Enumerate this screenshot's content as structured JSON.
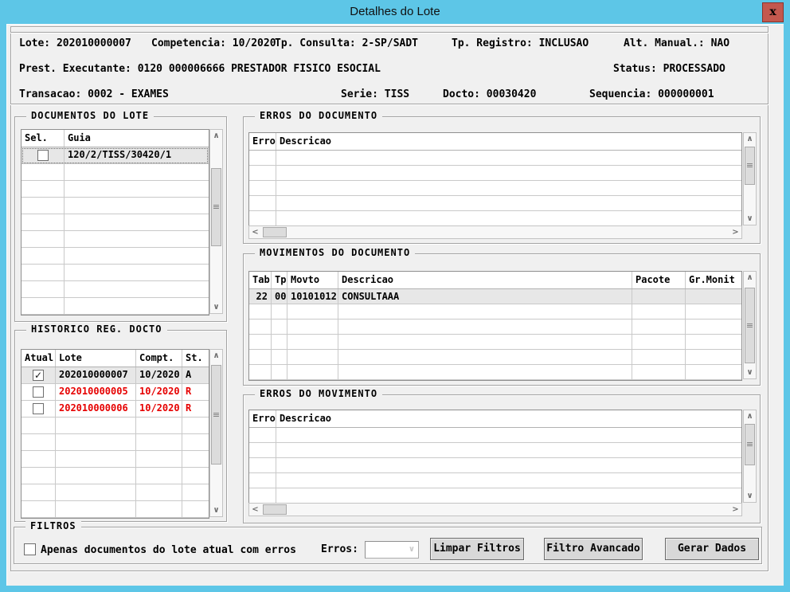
{
  "window": {
    "title": "Detalhes do Lote",
    "close_label": "x"
  },
  "colors": {
    "titlebar": "#5dc6e7",
    "panel_bg": "#f0f0f0",
    "close_bg": "#c3584e",
    "close_border": "#8b332b",
    "red_text": "#e60000",
    "selected_row": "#e7e7e7"
  },
  "icons": {
    "scroll_up": "∧",
    "scroll_down": "∨",
    "scroll_left": "<",
    "scroll_right": ">",
    "grip": "≡",
    "chevron_down": "∨",
    "check": "✓"
  },
  "header": {
    "lote": "Lote: 202010000007",
    "competencia": "Competencia: 10/2020",
    "tp_consulta": "Tp. Consulta: 2-SP/SADT",
    "tp_registro": "Tp. Registro: INCLUSAO",
    "alt_manual": "Alt. Manual.: NAO",
    "prest_executante": "Prest. Executante: 0120 000006666 PRESTADOR FISICO ESOCIAL",
    "status": "Status: PROCESSADO",
    "transacao": "Transacao: 0002 - EXAMES",
    "serie": "Serie: TISS",
    "docto": "Docto: 00030420",
    "sequencia": "Sequencia: 000000001"
  },
  "panels": {
    "documentos_lote": {
      "title": "DOCUMENTOS DO LOTE",
      "columns": [
        "Sel.",
        "Guia"
      ],
      "rows": [
        {
          "cells": [
            "",
            "120/2/TISS/30420/1"
          ],
          "checkbox": false,
          "selected": true,
          "focused": true
        }
      ]
    },
    "historico": {
      "title": "HISTORICO REG. DOCTO",
      "columns": [
        "Atual",
        "Lote",
        "Compt.",
        "St."
      ],
      "rows": [
        {
          "cells": [
            "",
            "202010000007",
            "10/2020",
            "A"
          ],
          "checkbox": true,
          "selected": true
        },
        {
          "cells": [
            "",
            "202010000005",
            "10/2020",
            "R"
          ],
          "checkbox": false,
          "red": true
        },
        {
          "cells": [
            "",
            "202010000006",
            "10/2020",
            "R"
          ],
          "checkbox": false,
          "red": true
        }
      ]
    },
    "erros_documento": {
      "title": "ERROS DO DOCUMENTO",
      "columns": [
        "Erro",
        "Descricao"
      ],
      "rows": []
    },
    "movimentos": {
      "title": "MOVIMENTOS DO DOCUMENTO",
      "columns": [
        "Tab",
        "Tp",
        "Movto",
        "Descricao",
        "Pacote",
        "Gr.Monit"
      ],
      "rows": [
        {
          "cells": [
            "22",
            "00",
            "10101012",
            "CONSULTAAA",
            "",
            ""
          ],
          "selected": true
        }
      ]
    },
    "erros_movimento": {
      "title": "ERROS DO MOVIMENTO",
      "columns": [
        "Erro",
        "Descricao"
      ],
      "rows": []
    }
  },
  "filtros": {
    "title": "FILTROS",
    "checkbox_label": "Apenas documentos do lote atual com erros",
    "checkbox_checked": false,
    "erros_label": "Erros:",
    "erros_value": "",
    "buttons": {
      "limpar": "Limpar Filtros",
      "avancado": "Filtro Avancado",
      "gerar": "Gerar Dados"
    }
  }
}
